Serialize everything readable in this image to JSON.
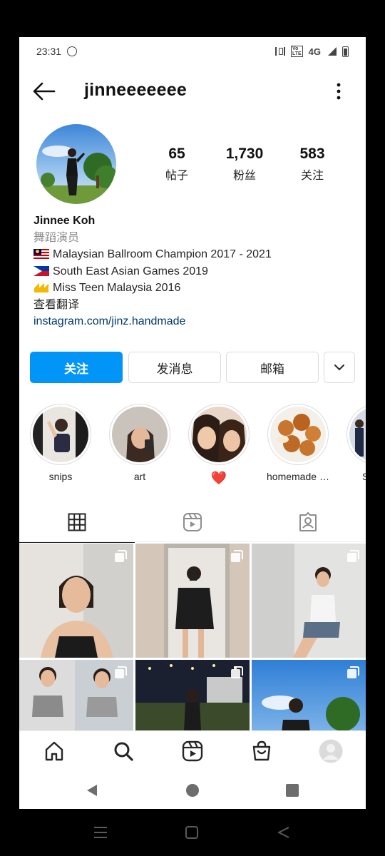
{
  "status": {
    "time": "23:31",
    "network": "4G"
  },
  "header": {
    "username": "jinneeeeeee"
  },
  "stats": [
    {
      "num": "65",
      "label": "帖子"
    },
    {
      "num": "1,730",
      "label": "粉丝"
    },
    {
      "num": "583",
      "label": "关注"
    }
  ],
  "bio": {
    "name": "Jinnee Koh",
    "category": "舞蹈演员",
    "lines": [
      "Malaysian Ballroom Champion 2017 - 2021",
      "South East Asian Games 2019",
      "Miss Teen Malaysia 2016"
    ],
    "translate": "查看翻译",
    "link": "instagram.com/jinz.handmade"
  },
  "buttons": {
    "follow": "关注",
    "message": "发消息",
    "email": "邮箱"
  },
  "highlights": [
    {
      "label": "snips"
    },
    {
      "label": "art"
    },
    {
      "label": "❤️"
    },
    {
      "label": "homemade y..."
    },
    {
      "label": "SEA G"
    }
  ],
  "tabs": [
    "grid-icon",
    "reels-icon",
    "tagged-icon"
  ],
  "colors": {
    "accent": "#0095f6",
    "link": "#00376b",
    "heart": "#e0001b"
  },
  "bottom_nav": [
    "home-icon",
    "search-icon",
    "reels-icon",
    "shop-icon",
    "profile-avatar"
  ]
}
